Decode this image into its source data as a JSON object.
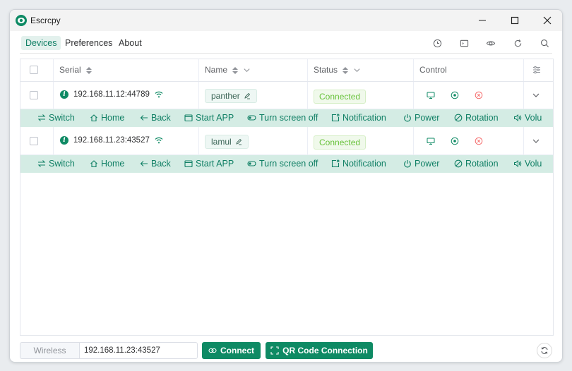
{
  "app": {
    "title": "Escrcpy",
    "logo_icon": "escrcpy-logo-icon"
  },
  "colors": {
    "primary": "#0e8a64",
    "primary_light": "#d4ece4",
    "success": "#67c23a",
    "danger": "#f56c6c"
  },
  "nav": {
    "tabs": [
      {
        "label": "Devices",
        "active": true
      },
      {
        "label": "Preferences",
        "active": false
      },
      {
        "label": "About",
        "active": false
      }
    ],
    "tools": [
      "history-icon",
      "terminal-icon",
      "eye-icon",
      "refresh-icon",
      "search-icon"
    ]
  },
  "table": {
    "headers": {
      "serial": "Serial",
      "name": "Name",
      "status": "Status",
      "control": "Control"
    },
    "rows": [
      {
        "serial": "192.168.11.12:44789",
        "name": "panther",
        "status": "Connected",
        "actions": [
          "Switch",
          "Home",
          "Back",
          "Start APP",
          "Turn screen off",
          "Notification",
          "Power",
          "Rotation",
          "Volu"
        ]
      },
      {
        "serial": "192.168.11.23:43527",
        "name": "lamul",
        "status": "Connected",
        "actions": [
          "Switch",
          "Home",
          "Back",
          "Start APP",
          "Turn screen off",
          "Notification",
          "Power",
          "Rotation",
          "Volu"
        ]
      }
    ]
  },
  "footer": {
    "wireless_label": "Wireless",
    "ip_value": "192.168.11.23:43527",
    "connect_label": "Connect",
    "qr_label": "QR Code Connection"
  }
}
